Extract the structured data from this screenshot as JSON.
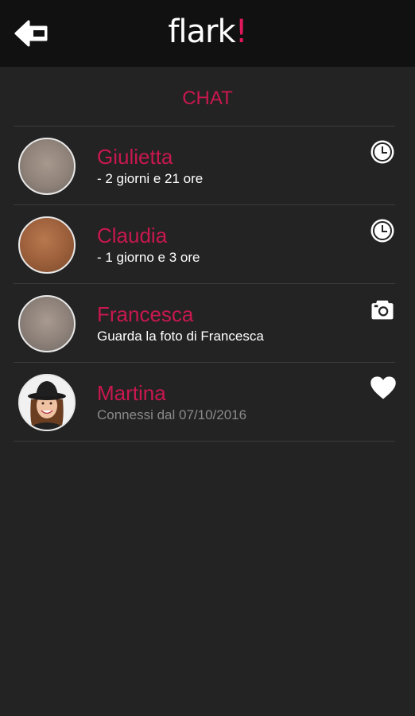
{
  "header": {
    "logo_text": "flark",
    "logo_bang": "!"
  },
  "section_title": "CHAT",
  "chats": [
    {
      "name": "Giulietta",
      "subtitle": "- 2 giorni e 21 ore",
      "icon": "clock-icon"
    },
    {
      "name": "Claudia",
      "subtitle": "- 1 giorno e 3 ore",
      "icon": "clock-icon"
    },
    {
      "name": "Francesca",
      "subtitle": "Guarda la foto di Francesca",
      "icon": "camera-icon"
    },
    {
      "name": "Martina",
      "subtitle": "Connessi dal 07/10/2016",
      "icon": "heart-icon"
    }
  ],
  "colors": {
    "accent": "#c8184f",
    "background": "#232323",
    "topbar": "#111111"
  }
}
